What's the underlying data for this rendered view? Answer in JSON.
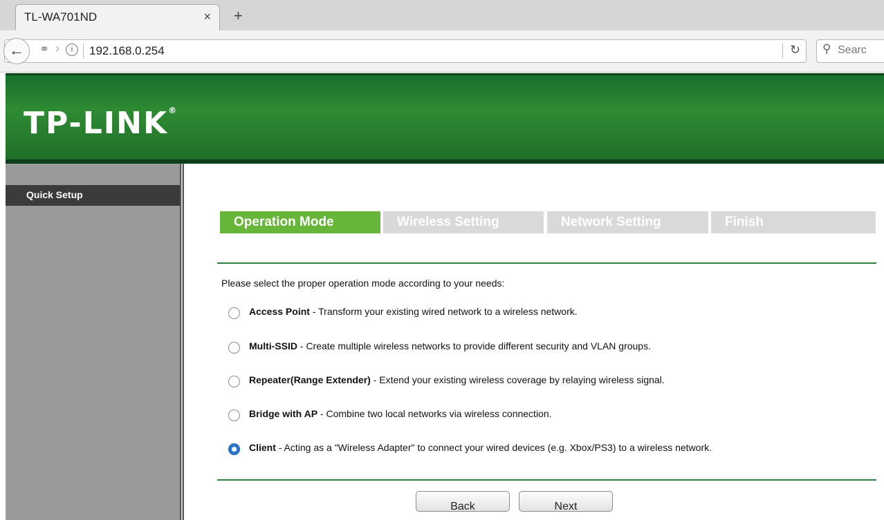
{
  "browser": {
    "tab_title": "TL-WA701ND",
    "tab_close": "×",
    "new_tab": "+",
    "url": "192.168.0.254",
    "search_placeholder": "Searc"
  },
  "header": {
    "logo": "TP-LINK",
    "logo_mark": "®"
  },
  "sidebar": {
    "items": [
      {
        "label": "Quick Setup"
      }
    ]
  },
  "steps": [
    {
      "label": "Operation Mode",
      "active": true
    },
    {
      "label": "Wireless Setting",
      "active": false
    },
    {
      "label": "Network Setting",
      "active": false
    },
    {
      "label": "Finish",
      "active": false
    }
  ],
  "main": {
    "prompt": "Please select the proper operation mode according to your needs:",
    "options": [
      {
        "name": "Access Point",
        "desc": " - Transform your existing wired network to a wireless network.",
        "checked": false
      },
      {
        "name": "Multi-SSID",
        "desc": " - Create multiple wireless networks to provide different security and VLAN groups.",
        "checked": false
      },
      {
        "name": "Repeater(Range Extender)",
        "desc": " - Extend your existing wireless coverage by relaying wireless signal.",
        "checked": false
      },
      {
        "name": "Bridge with AP",
        "desc": " - Combine two local networks via wireless connection.",
        "checked": false
      },
      {
        "name": "Client",
        "desc": " - Acting as a \"Wireless Adapter\" to connect your wired devices (e.g. Xbox/PS3) to a wireless network.",
        "checked": true
      }
    ],
    "back_label": "Back",
    "next_label": "Next"
  },
  "colors": {
    "accent_green": "#67b63a",
    "header_green": "#2e8b33",
    "radio_blue": "#2c78d0"
  }
}
